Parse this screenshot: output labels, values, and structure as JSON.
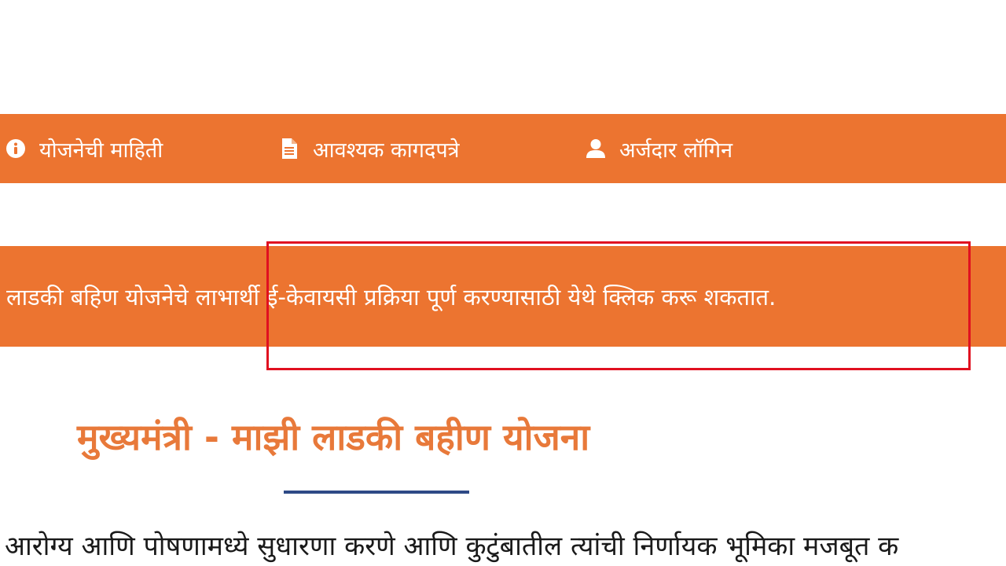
{
  "nav": {
    "items": [
      {
        "label": "योजनेची माहिती",
        "icon": "info-circle-icon"
      },
      {
        "label": "आवश्यक कागदपत्रे",
        "icon": "document-icon"
      },
      {
        "label": "अर्जदार लॉगिन",
        "icon": "user-icon"
      }
    ]
  },
  "notice": {
    "text": "लाडकी बहिण योजनेचे लाभार्थी ई-केवायसी प्रक्रिया पूर्ण करण्यासाठी येथे क्लिक करू शकतात."
  },
  "main": {
    "title": "मुख्यमंत्री - माझी लाडकी बहीण योजना",
    "body_text": "आरोग्य आणि पोषणामध्ये सुधारणा करणे आणि कुटुंबातील त्यांची निर्णायक भूमिका मजबूत क"
  },
  "colors": {
    "accent": "#ec7430",
    "title": "#e8793a",
    "divider": "#2e4a86",
    "highlight": "#e01020"
  }
}
